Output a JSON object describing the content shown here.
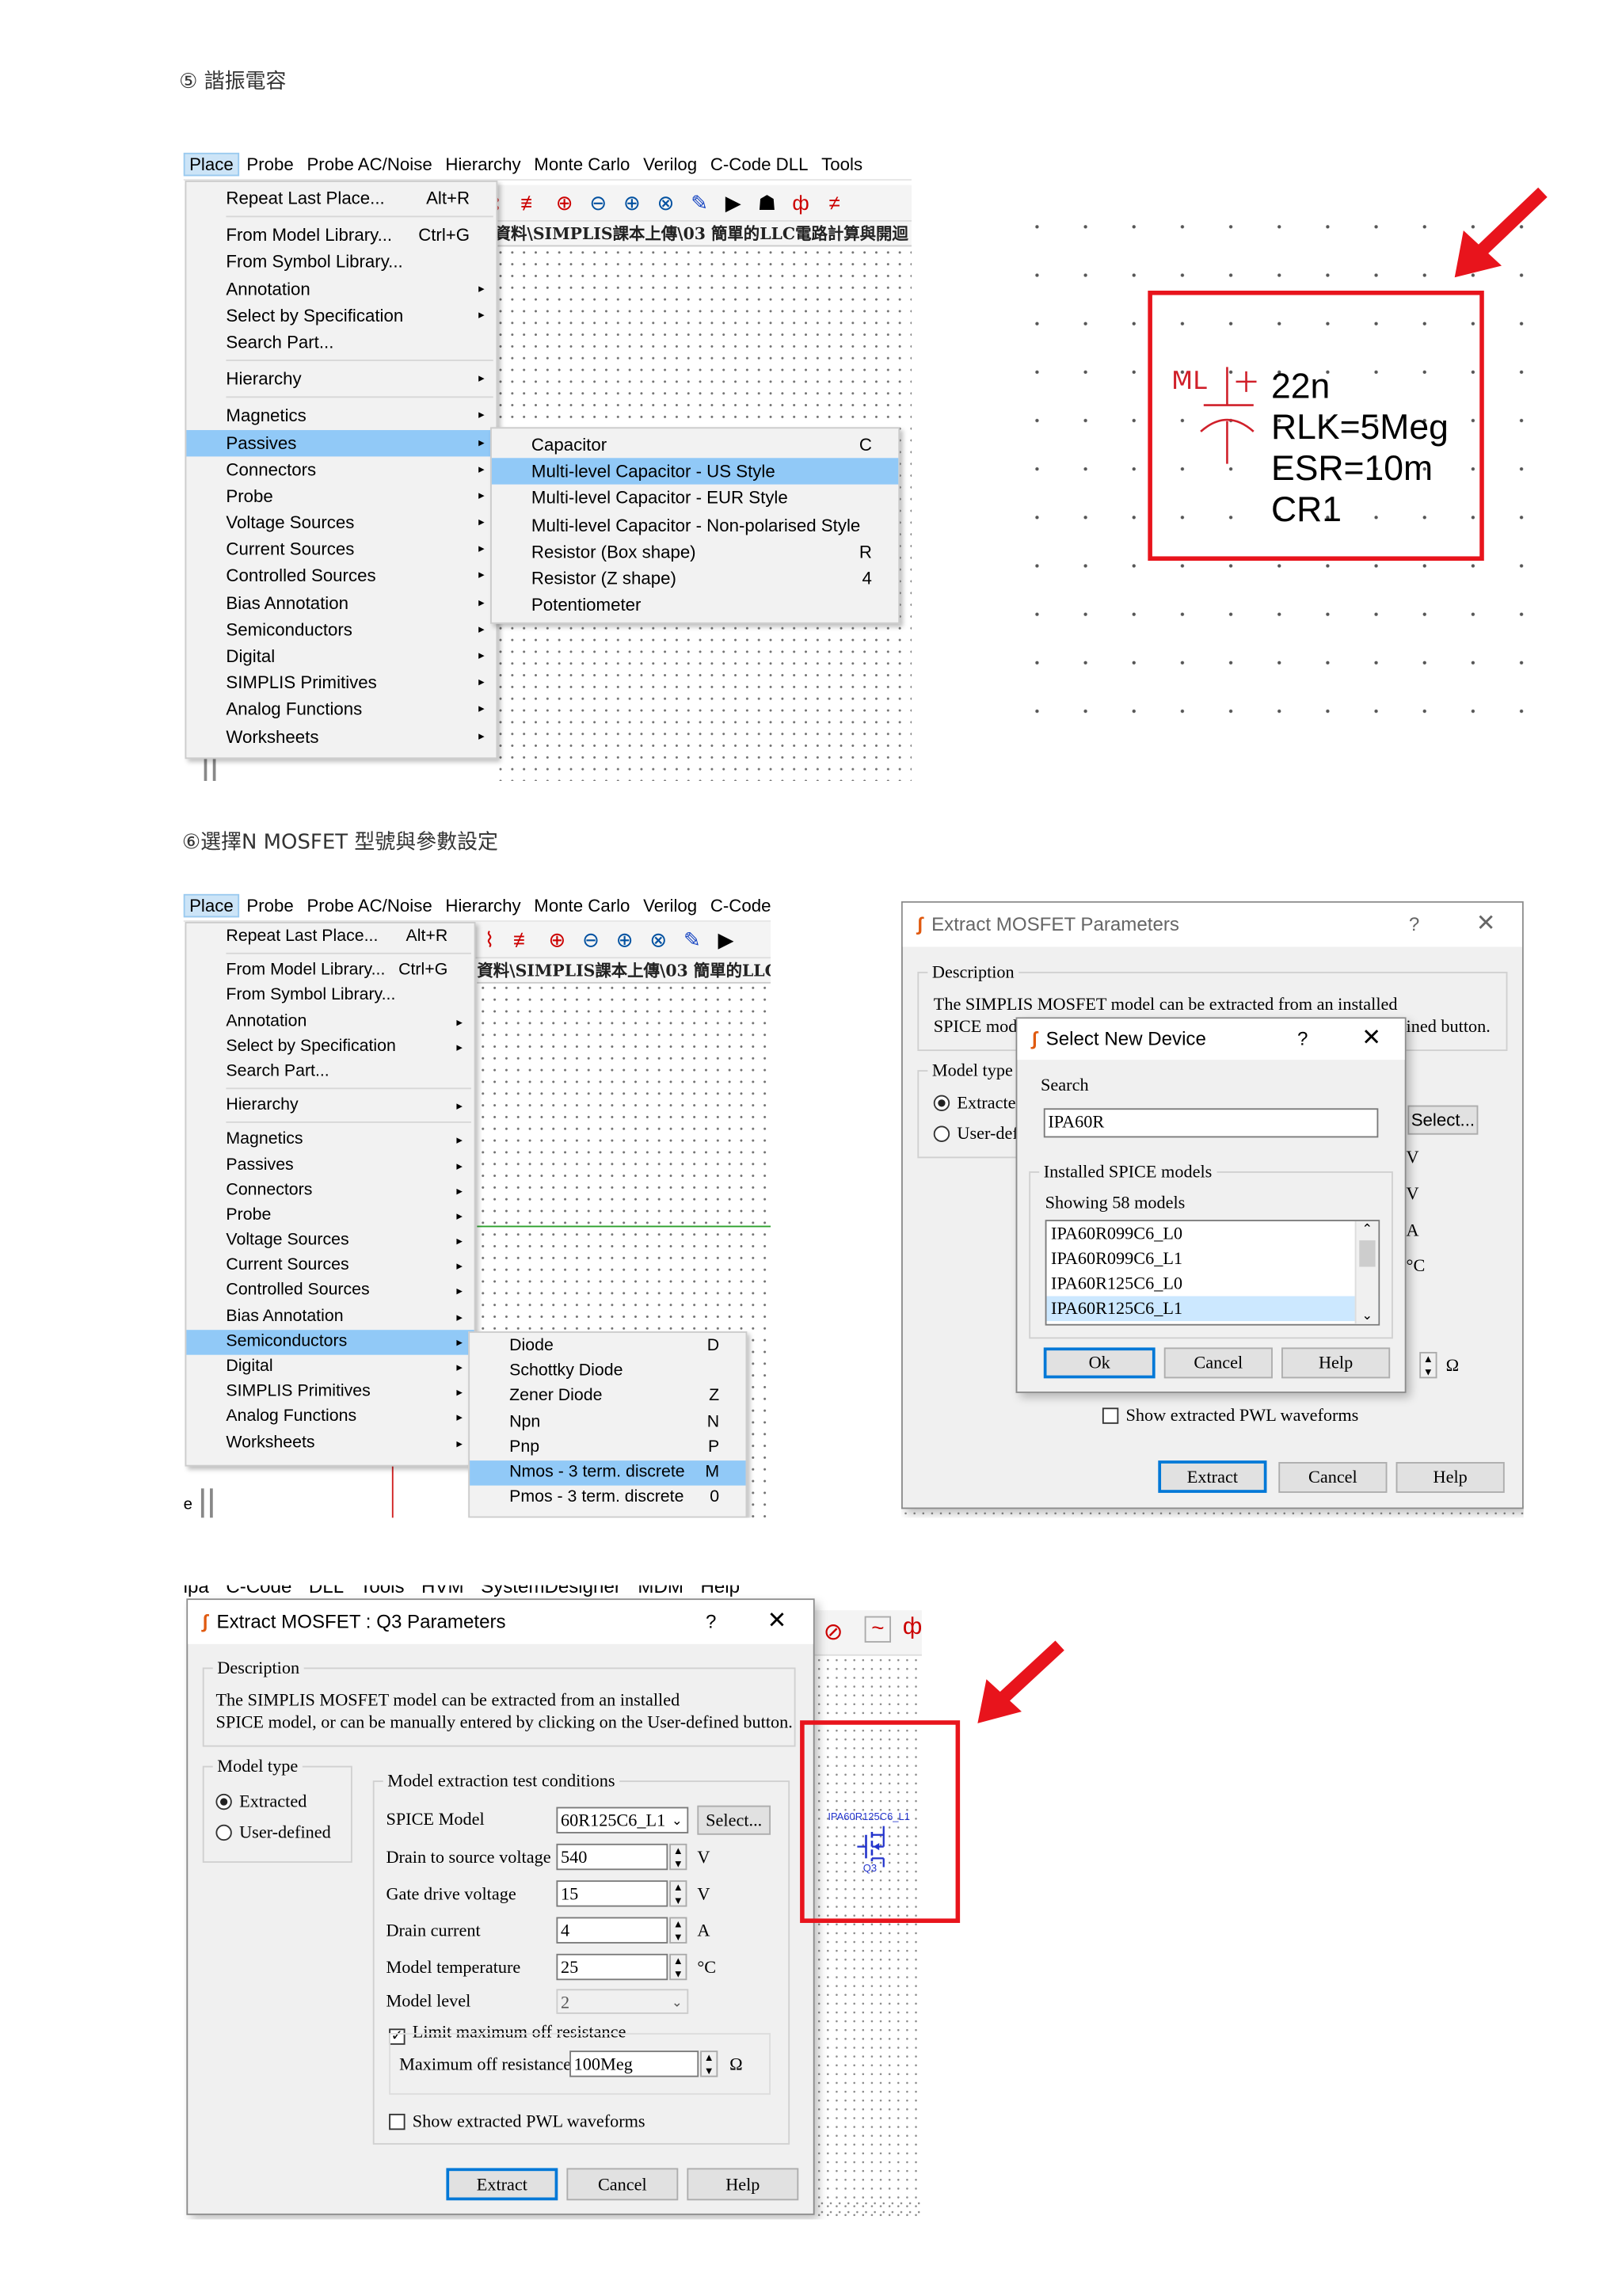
{
  "section5": {
    "heading": "⑤ 諧振電容",
    "menubar": [
      "Place",
      "Probe",
      "Probe AC/Noise",
      "Hierarchy",
      "Monte Carlo",
      "Verilog",
      "C-Code DLL",
      "Tools"
    ],
    "path_text": "資料\\SIMPLIS課本上傳\\03  簡單的LLC電路計算與開迴",
    "place_menu": [
      {
        "label": "Repeat Last Place...",
        "shortcut": "Alt+R"
      },
      {
        "label": "From Model Library...",
        "shortcut": "Ctrl+G"
      },
      {
        "label": "From Symbol Library...",
        "shortcut": ""
      },
      {
        "label": "Annotation",
        "shortcut": ""
      },
      {
        "label": "Select by Specification",
        "shortcut": ""
      },
      {
        "label": "Search Part...",
        "shortcut": ""
      },
      {
        "label": "Hierarchy",
        "shortcut": ""
      },
      {
        "label": "Magnetics",
        "shortcut": ""
      },
      {
        "label": "Passives",
        "shortcut": ""
      },
      {
        "label": "Connectors",
        "shortcut": ""
      },
      {
        "label": "Probe",
        "shortcut": ""
      },
      {
        "label": "Voltage Sources",
        "shortcut": ""
      },
      {
        "label": "Current Sources",
        "shortcut": ""
      },
      {
        "label": "Controlled Sources",
        "shortcut": ""
      },
      {
        "label": "Bias Annotation",
        "shortcut": ""
      },
      {
        "label": "Semiconductors",
        "shortcut": ""
      },
      {
        "label": "Digital",
        "shortcut": ""
      },
      {
        "label": "SIMPLIS Primitives",
        "shortcut": ""
      },
      {
        "label": "Analog Functions",
        "shortcut": ""
      },
      {
        "label": "Worksheets",
        "shortcut": ""
      }
    ],
    "passives_submenu": [
      {
        "label": "Capacitor",
        "shortcut": "C"
      },
      {
        "label": "Multi-level Capacitor - US Style",
        "shortcut": ""
      },
      {
        "label": "Multi-level Capacitor - EUR Style",
        "shortcut": ""
      },
      {
        "label": "Multi-level Capacitor - Non-polarised Style",
        "shortcut": ""
      },
      {
        "label": "Resistor (Box shape)",
        "shortcut": "R"
      },
      {
        "label": "Resistor (Z shape)",
        "shortcut": "4"
      },
      {
        "label": "Potentiometer",
        "shortcut": ""
      }
    ],
    "capacitor_symbol": {
      "prefix": "ML",
      "lines": [
        "22n",
        "RLK=5Meg",
        "ESR=10m",
        "CR1"
      ]
    }
  },
  "section6": {
    "heading": "⑥選擇N MOSFET 型號與參數設定",
    "menubar": [
      "Place",
      "Probe",
      "Probe AC/Noise",
      "Hierarchy",
      "Monte Carlo",
      "Verilog",
      "C-Code"
    ],
    "path_text": "資料\\SIMPLIS課本上傳\\03  簡單的LLC電",
    "partial_char": "e",
    "place_menu": [
      {
        "label": "Repeat Last Place...",
        "shortcut": "Alt+R"
      },
      {
        "label": "From Model Library...",
        "shortcut": "Ctrl+G"
      },
      {
        "label": "From Symbol Library...",
        "shortcut": ""
      },
      {
        "label": "Annotation",
        "shortcut": ""
      },
      {
        "label": "Select by Specification",
        "shortcut": ""
      },
      {
        "label": "Search Part...",
        "shortcut": ""
      },
      {
        "label": "Hierarchy",
        "shortcut": ""
      },
      {
        "label": "Magnetics",
        "shortcut": ""
      },
      {
        "label": "Passives",
        "shortcut": ""
      },
      {
        "label": "Connectors",
        "shortcut": ""
      },
      {
        "label": "Probe",
        "shortcut": ""
      },
      {
        "label": "Voltage Sources",
        "shortcut": ""
      },
      {
        "label": "Current Sources",
        "shortcut": ""
      },
      {
        "label": "Controlled Sources",
        "shortcut": ""
      },
      {
        "label": "Bias Annotation",
        "shortcut": ""
      },
      {
        "label": "Semiconductors",
        "shortcut": ""
      },
      {
        "label": "Digital",
        "shortcut": ""
      },
      {
        "label": "SIMPLIS Primitives",
        "shortcut": ""
      },
      {
        "label": "Analog Functions",
        "shortcut": ""
      },
      {
        "label": "Worksheets",
        "shortcut": ""
      }
    ],
    "semiconductors_submenu": [
      {
        "label": "Diode",
        "shortcut": "D"
      },
      {
        "label": "Schottky Diode",
        "shortcut": ""
      },
      {
        "label": "Zener Diode",
        "shortcut": "Z"
      },
      {
        "label": "Npn",
        "shortcut": "N"
      },
      {
        "label": "Pnp",
        "shortcut": "P"
      },
      {
        "label": "Nmos - 3 term. discrete",
        "shortcut": "M"
      },
      {
        "label": "Pmos - 3 term. discrete",
        "shortcut": "0"
      }
    ],
    "extract_dialog_back": {
      "title": "Extract MOSFET Parameters",
      "description_label": "Description",
      "desc_line1": "The SIMPLIS MOSFET model can be extracted from an installed",
      "desc_line2_left": "SPICE mode",
      "desc_line2_right": "ined button.",
      "model_type_label": "Model type",
      "radio_extracted": "Extracte",
      "radio_user": "User-def",
      "select_button": "Select...",
      "unit_v1": "V",
      "unit_v2": "V",
      "unit_a": "A",
      "unit_c": "°C",
      "unit_ohm": "Ω",
      "show_pwl": "Show extracted PWL waveforms",
      "extract": "Extract",
      "cancel": "Cancel",
      "help": "Help"
    },
    "select_device_dialog": {
      "title": "Select New Device",
      "search_label": "Search",
      "search_value": "IPA60R",
      "installed_label": "Installed SPICE models",
      "showing": "Showing 58 models",
      "models": [
        "IPA60R099C6_L0",
        "IPA60R099C6_L1",
        "IPA60R125C6_L0",
        "IPA60R125C6_L1"
      ],
      "selected_index": 3,
      "ok": "Ok",
      "cancel": "Cancel",
      "help": "Help"
    }
  },
  "section7": {
    "cut_menubar": "ipa   C-Code DLL   Tools   HVM   SystemDesigner   MDM   Help",
    "dialog": {
      "title": "Extract MOSFET : Q3 Parameters",
      "description_label": "Description",
      "desc_line1": "The SIMPLIS MOSFET model can be extracted from an installed",
      "desc_line2": "SPICE model, or can be manually entered by clicking on the User-defined button.",
      "model_type_label": "Model type",
      "radio_extracted": "Extracted",
      "radio_user": "User-defined",
      "conditions_label": "Model extraction test conditions",
      "rows": [
        {
          "label": "SPICE Model",
          "value": "60R125C6_L1",
          "unit": ""
        },
        {
          "label": "Drain to source voltage",
          "value": "540",
          "unit": "V"
        },
        {
          "label": "Gate drive voltage",
          "value": "15",
          "unit": "V"
        },
        {
          "label": "Drain current",
          "value": "4",
          "unit": "A"
        },
        {
          "label": "Model temperature",
          "value": "25",
          "unit": "°C"
        },
        {
          "label": "Model level",
          "value": "2",
          "unit": ""
        }
      ],
      "select_button": "Select...",
      "limit_label": "Limit maximum off resistance",
      "max_off_label": "Maximum off resistance",
      "max_off_value": "100Meg",
      "ohm": "Ω",
      "show_pwl": "Show extracted PWL waveforms",
      "extract": "Extract",
      "cancel": "Cancel",
      "help": "Help"
    },
    "mosfet_symbol": {
      "model_label": "IPA60R125C6_L1",
      "ref": "Q3"
    }
  },
  "colors": {
    "highlight_box": "#e8141c",
    "arrow": "#e8141c",
    "menu_highlight": "#91c9f7",
    "symbol_red": "#d0202a",
    "symbol_blue": "#2233cc"
  }
}
